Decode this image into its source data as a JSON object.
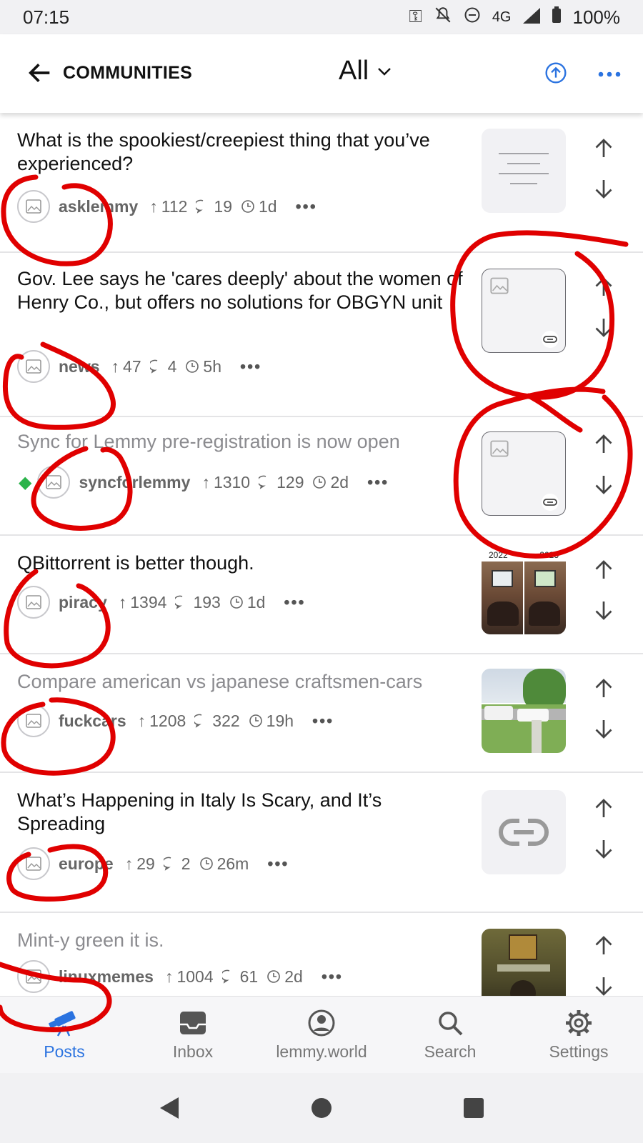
{
  "status_bar": {
    "time": "07:15",
    "network": "4G",
    "battery": "100%"
  },
  "header": {
    "back_label": "COMMUNITIES",
    "feed_label": "All"
  },
  "posts": [
    {
      "title": "What is the spookiest/creepiest thing that you’ve experienced?",
      "community": "asklemmy",
      "score": "112",
      "comments": "19",
      "age": "1d"
    },
    {
      "title": "Gov. Lee says he 'cares deeply' about the women of Henry Co., but offers no solutions for OBGYN unit",
      "community": "news",
      "score": "47",
      "comments": "4",
      "age": "5h"
    },
    {
      "title": "Sync for Lemmy pre-registration is now open",
      "community": "syncforlemmy",
      "score": "1310",
      "comments": "129",
      "age": "2d"
    },
    {
      "title": "QBittorrent is better though.",
      "community": "piracy",
      "score": "1394",
      "comments": "193",
      "age": "1d",
      "thumb_caption_left": "2022",
      "thumb_caption_right": "2023"
    },
    {
      "title": "Compare american vs japanese craftsmen-cars",
      "community": "fuckcars",
      "score": "1208",
      "comments": "322",
      "age": "19h"
    },
    {
      "title": "What’s Happening in Italy Is Scary, and It’s Spreading",
      "community": "europe",
      "score": "29",
      "comments": "2",
      "age": "26m"
    },
    {
      "title": "Mint-y green it is.",
      "community": "linuxmemes",
      "score": "1004",
      "comments": "61",
      "age": "2d"
    }
  ],
  "tabs": [
    {
      "label": "Posts",
      "icon": "telescope-icon"
    },
    {
      "label": "Inbox",
      "icon": "inbox-icon"
    },
    {
      "label": "lemmy.world",
      "icon": "account-icon"
    },
    {
      "label": "Search",
      "icon": "search-icon"
    },
    {
      "label": "Settings",
      "icon": "gear-icon"
    }
  ],
  "colors": {
    "accent": "#2b73e0",
    "annotation": "#e00000",
    "read_text": "#8b8b8f"
  }
}
